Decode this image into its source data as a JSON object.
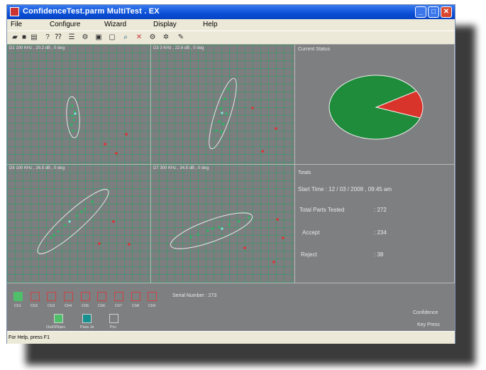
{
  "window": {
    "title": "ConfidenceTest.parm  MultiTest . EX"
  },
  "menu": [
    "File",
    "Configure",
    "Wizard",
    "Display",
    "Help"
  ],
  "toolbar_icons": [
    "open-icon",
    "save-icon",
    "print-icon",
    "help-icon",
    "question-icon",
    "settings-icon",
    "tools-icon",
    "window-icon",
    "document-icon",
    "zoom-icon",
    "cursor-icon",
    "config-icon",
    "chart-icon",
    "pen-icon"
  ],
  "plots": [
    {
      "label": "D1 100 KHz , 20.2 dB , 0 deg"
    },
    {
      "label": "D3 3 KHz , 22.6 dB , 0 deg"
    },
    {
      "label": "D5 100 KHz , 26.5 dB , 0 deg"
    },
    {
      "label": "D7 300 KHz , 34.5 dB , 0 deg"
    }
  ],
  "status": {
    "title": "Current Status",
    "accept_color": "#1e8c3a",
    "reject_color": "#d9342b"
  },
  "chart_data": {
    "type": "pie",
    "title": "Current Status",
    "categories": [
      "Accept",
      "Reject"
    ],
    "values": [
      234,
      38
    ],
    "colors": [
      "#1e8c3a",
      "#d9342b"
    ]
  },
  "totals": {
    "title": "Totals",
    "start_time": "Start Time :  12 / 03 / 2008 ,  09:45 am",
    "total_label": "Total Parts Tested",
    "total_value": ":   272",
    "accept_label": "Accept",
    "accept_value": ":   234",
    "reject_label": "Reject",
    "reject_value": ":   38"
  },
  "channels": [
    "Ch1",
    "Ch2",
    "Ch3",
    "Ch4",
    "Ch5",
    "Ch6",
    "Ch7",
    "Ch8",
    "Ch9"
  ],
  "serial": "Serial Number :  273",
  "legend": [
    {
      "label": "OutOfSpec",
      "color": "#4fbf6a"
    },
    {
      "label": "Pass Je",
      "color": "#169090"
    },
    {
      "label": "Pcc",
      "color": "#7e7f81"
    }
  ],
  "right_labels": {
    "confidence": "Confidence",
    "keypress": "Key Press"
  },
  "statusbar": "For Help, press F1"
}
